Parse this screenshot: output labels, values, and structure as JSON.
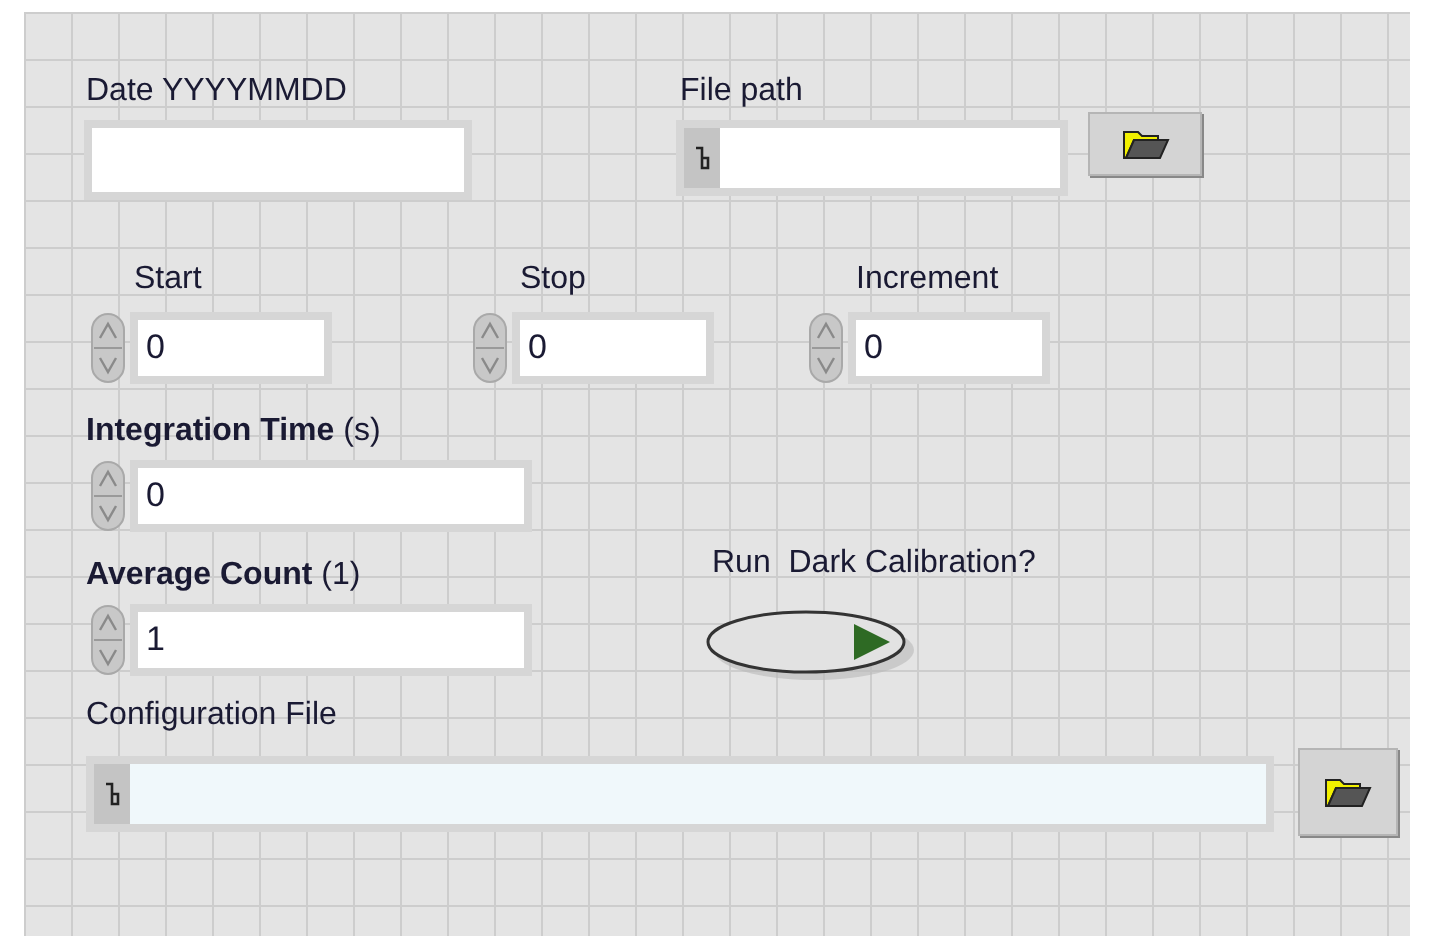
{
  "row_1": [
    {
      "kind": "text",
      "label": "Date YYYYMMDD"
    },
    {
      "kind": "path",
      "label": "File path"
    }
  ],
  "row_2": [
    {
      "kind": "numeric",
      "label": "Start",
      "value": "0"
    },
    {
      "kind": "numeric",
      "label": "Stop",
      "value": "0"
    },
    {
      "kind": "numeric",
      "label": "Increment",
      "value": "0"
    }
  ],
  "integration_time": {
    "kind": "numeric",
    "label": "**Integration Time** (s)",
    "value": "0"
  },
  "average_count": {
    "kind": "numeric",
    "label": "**Average Count** (1)",
    "value": "1"
  },
  "dark_calibration": {
    "label": "Run  Dark Calibration?",
    "on": false
  },
  "configuration_file": {
    "kind": "path",
    "label": "Configuration File"
  }
}
